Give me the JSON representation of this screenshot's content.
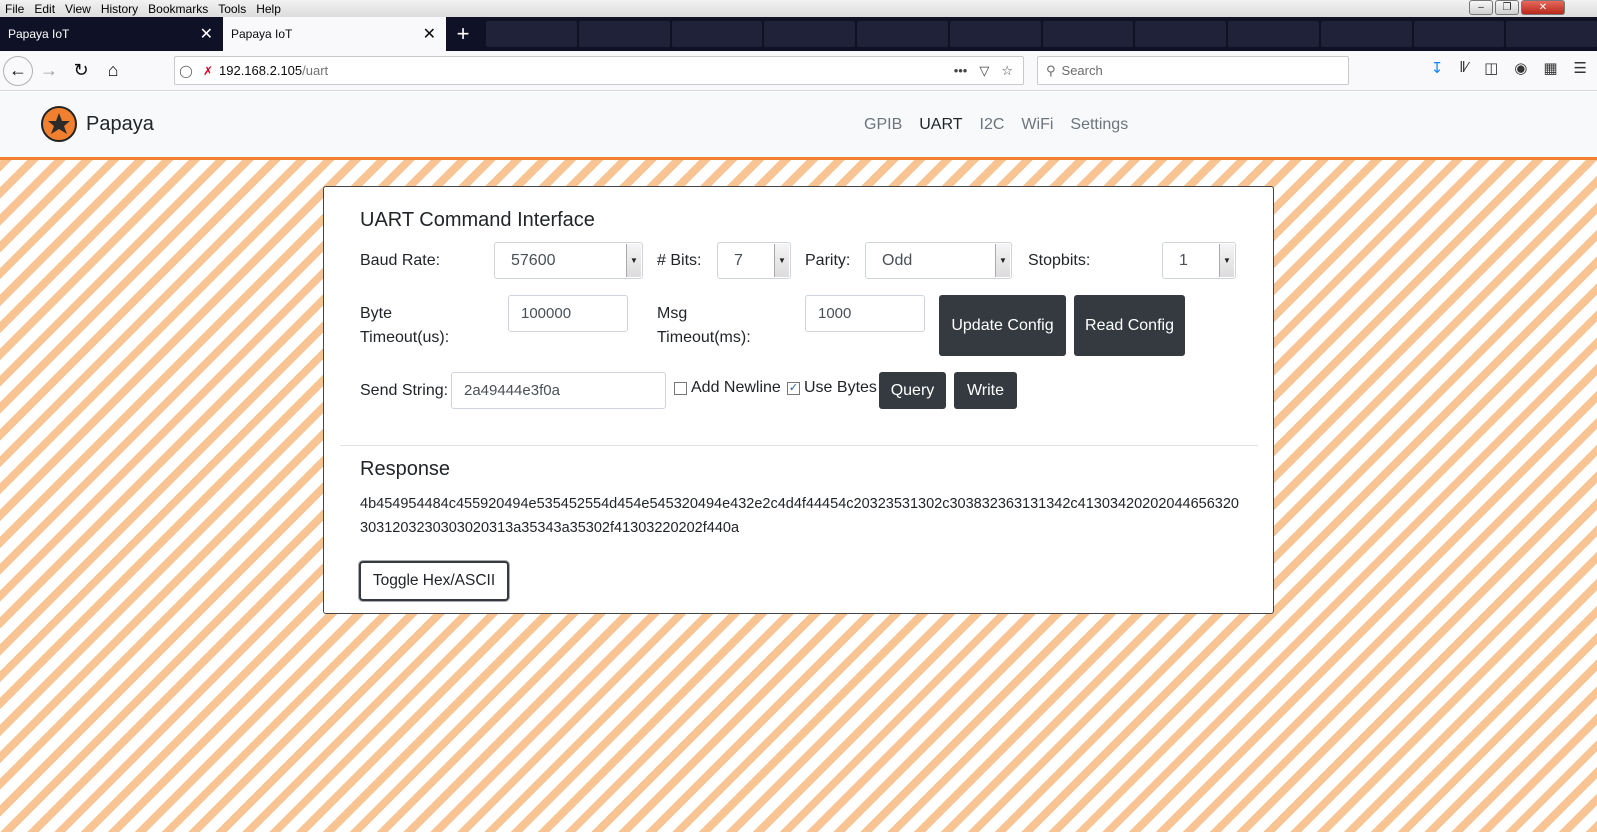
{
  "browser": {
    "menu": [
      "File",
      "Edit",
      "View",
      "History",
      "Bookmarks",
      "Tools",
      "Help"
    ],
    "tabs": [
      {
        "title": "Papaya IoT"
      },
      {
        "title": "Papaya IoT"
      }
    ],
    "url_host": "192.168.2.105",
    "url_path": "/uart",
    "search_placeholder": "Search"
  },
  "site": {
    "brand": "Papaya",
    "nav": [
      "GPIB",
      "UART",
      "I2C",
      "WiFi",
      "Settings"
    ],
    "active_nav": "UART",
    "accent_color": "#f0802f"
  },
  "uart": {
    "title": "UART Command Interface",
    "baud_label": "Baud Rate:",
    "baud_value": "57600",
    "bits_label": "# Bits:",
    "bits_value": "7",
    "parity_label": "Parity:",
    "parity_value": "Odd",
    "stopbits_label": "Stopbits:",
    "stopbits_value": "1",
    "byte_timeout_label_1": "Byte",
    "byte_timeout_label_2": "Timeout(us):",
    "byte_timeout_value": "100000",
    "msg_timeout_label_1": "Msg",
    "msg_timeout_label_2": "Timeout(ms):",
    "msg_timeout_value": "1000",
    "update_config": "Update Config",
    "read_config": "Read Config",
    "send_label": "Send String:",
    "send_value": "2a49444e3f0a",
    "add_newline": "Add Newline",
    "add_newline_checked": false,
    "use_bytes": "Use Bytes",
    "use_bytes_checked": true,
    "query": "Query",
    "write": "Write"
  },
  "response": {
    "title": "Response",
    "text": "4b454954484c455920494e535452554d454e545320494e432e2c4d4f44454c20323531302c303832363131342c413034202020446563203031203230303020313a35343a35302f41303220202f440a",
    "toggle": "Toggle Hex/ASCII"
  }
}
